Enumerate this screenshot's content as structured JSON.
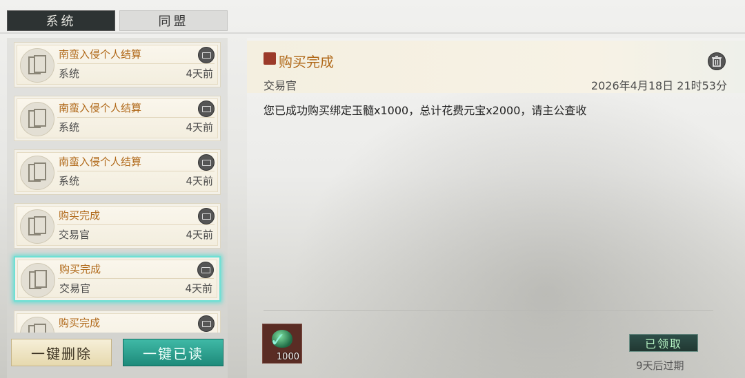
{
  "tabs": {
    "system": "系统",
    "alliance": "同盟"
  },
  "mail_list": [
    {
      "title": "南蛮入侵个人结算",
      "sender": "系统",
      "time": "4天前"
    },
    {
      "title": "南蛮入侵个人结算",
      "sender": "系统",
      "time": "4天前"
    },
    {
      "title": "南蛮入侵个人结算",
      "sender": "系统",
      "time": "4天前"
    },
    {
      "title": "购买完成",
      "sender": "交易官",
      "time": "4天前"
    },
    {
      "title": "购买完成",
      "sender": "交易官",
      "time": "4天前"
    },
    {
      "title": "购买完成",
      "sender": "",
      "time": ""
    }
  ],
  "buttons": {
    "delete_all": "一键删除",
    "read_all": "一键已读"
  },
  "detail": {
    "title": "购买完成",
    "sender": "交易官",
    "date": "2026年4月18日 21时53分",
    "body": "您已成功购买绑定玉髓x1000，总计花费元宝x2000，请主公查收",
    "attachment_qty": "1000",
    "claimed_label": "已领取",
    "expire_text": "9天后过期"
  },
  "colors": {
    "accent_title": "#b06818",
    "selected_glow": "#6fe0d4",
    "read_button": "#1e8a7a"
  }
}
